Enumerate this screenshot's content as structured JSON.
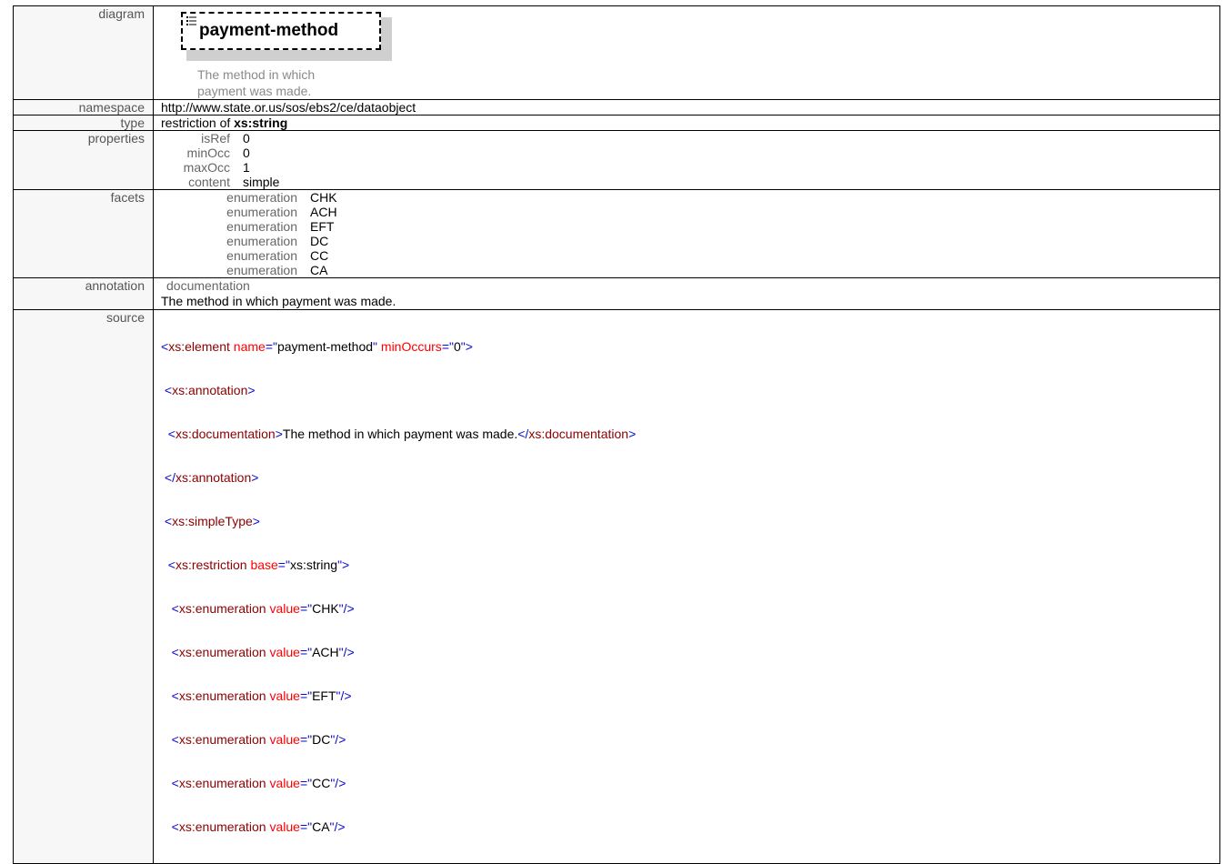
{
  "diagram": {
    "label": "diagram",
    "element_name": "payment-method",
    "element_doc": "The method in which payment was made.",
    "icon": "list-icon"
  },
  "namespace": {
    "label": "namespace",
    "value": "http://www.state.or.us/sos/ebs2/ce/dataobject"
  },
  "type": {
    "label": "type",
    "prefix": "restriction of ",
    "base": "xs:string"
  },
  "properties": {
    "label": "properties",
    "rows": [
      {
        "key": "isRef",
        "value": "0"
      },
      {
        "key": "minOcc",
        "value": "0"
      },
      {
        "key": "maxOcc",
        "value": "1"
      },
      {
        "key": "content",
        "value": "simple"
      }
    ]
  },
  "facets": {
    "label": "facets",
    "rows": [
      {
        "key": "enumeration",
        "value": "CHK"
      },
      {
        "key": "enumeration",
        "value": "ACH"
      },
      {
        "key": "enumeration",
        "value": "EFT"
      },
      {
        "key": "enumeration",
        "value": "DC"
      },
      {
        "key": "enumeration",
        "value": "CC"
      },
      {
        "key": "enumeration",
        "value": "CA"
      }
    ]
  },
  "annotation": {
    "label": "annotation",
    "kind": "documentation",
    "text": "The method in which payment was made."
  },
  "source": {
    "label": "source",
    "lines": [
      [
        {
          "t": "el",
          "s": "<"
        },
        {
          "t": "nm",
          "s": "xs:element"
        },
        {
          "t": "tx",
          "s": " "
        },
        {
          "t": "at",
          "s": "name"
        },
        {
          "t": "el",
          "s": "=\""
        },
        {
          "t": "av",
          "s": "payment-method"
        },
        {
          "t": "el",
          "s": "\""
        },
        {
          "t": "tx",
          "s": " "
        },
        {
          "t": "at",
          "s": "minOccurs"
        },
        {
          "t": "el",
          "s": "=\""
        },
        {
          "t": "av",
          "s": "0"
        },
        {
          "t": "el",
          "s": "\">"
        }
      ],
      [
        {
          "t": "tx",
          "s": " "
        },
        {
          "t": "el",
          "s": "<"
        },
        {
          "t": "nm",
          "s": "xs:annotation"
        },
        {
          "t": "el",
          "s": ">"
        }
      ],
      [
        {
          "t": "tx",
          "s": "  "
        },
        {
          "t": "el",
          "s": "<"
        },
        {
          "t": "nm",
          "s": "xs:documentation"
        },
        {
          "t": "el",
          "s": ">"
        },
        {
          "t": "tx",
          "s": "The method in which payment was made."
        },
        {
          "t": "el",
          "s": "</"
        },
        {
          "t": "nm",
          "s": "xs:documentation"
        },
        {
          "t": "el",
          "s": ">"
        }
      ],
      [
        {
          "t": "tx",
          "s": " "
        },
        {
          "t": "el",
          "s": "</"
        },
        {
          "t": "nm",
          "s": "xs:annotation"
        },
        {
          "t": "el",
          "s": ">"
        }
      ],
      [
        {
          "t": "tx",
          "s": " "
        },
        {
          "t": "el",
          "s": "<"
        },
        {
          "t": "nm",
          "s": "xs:simpleType"
        },
        {
          "t": "el",
          "s": ">"
        }
      ],
      [
        {
          "t": "tx",
          "s": "  "
        },
        {
          "t": "el",
          "s": "<"
        },
        {
          "t": "nm",
          "s": "xs:restriction"
        },
        {
          "t": "tx",
          "s": " "
        },
        {
          "t": "at",
          "s": "base"
        },
        {
          "t": "el",
          "s": "=\""
        },
        {
          "t": "av",
          "s": "xs:string"
        },
        {
          "t": "el",
          "s": "\">"
        }
      ],
      [
        {
          "t": "tx",
          "s": "   "
        },
        {
          "t": "el",
          "s": "<"
        },
        {
          "t": "nm",
          "s": "xs:enumeration"
        },
        {
          "t": "tx",
          "s": " "
        },
        {
          "t": "at",
          "s": "value"
        },
        {
          "t": "el",
          "s": "=\""
        },
        {
          "t": "av",
          "s": "CHK"
        },
        {
          "t": "el",
          "s": "\"/>"
        }
      ],
      [
        {
          "t": "tx",
          "s": "   "
        },
        {
          "t": "el",
          "s": "<"
        },
        {
          "t": "nm",
          "s": "xs:enumeration"
        },
        {
          "t": "tx",
          "s": " "
        },
        {
          "t": "at",
          "s": "value"
        },
        {
          "t": "el",
          "s": "=\""
        },
        {
          "t": "av",
          "s": "ACH"
        },
        {
          "t": "el",
          "s": "\"/>"
        }
      ],
      [
        {
          "t": "tx",
          "s": "   "
        },
        {
          "t": "el",
          "s": "<"
        },
        {
          "t": "nm",
          "s": "xs:enumeration"
        },
        {
          "t": "tx",
          "s": " "
        },
        {
          "t": "at",
          "s": "value"
        },
        {
          "t": "el",
          "s": "=\""
        },
        {
          "t": "av",
          "s": "EFT"
        },
        {
          "t": "el",
          "s": "\"/>"
        }
      ],
      [
        {
          "t": "tx",
          "s": "   "
        },
        {
          "t": "el",
          "s": "<"
        },
        {
          "t": "nm",
          "s": "xs:enumeration"
        },
        {
          "t": "tx",
          "s": " "
        },
        {
          "t": "at",
          "s": "value"
        },
        {
          "t": "el",
          "s": "=\""
        },
        {
          "t": "av",
          "s": "DC"
        },
        {
          "t": "el",
          "s": "\"/>"
        }
      ],
      [
        {
          "t": "tx",
          "s": "   "
        },
        {
          "t": "el",
          "s": "<"
        },
        {
          "t": "nm",
          "s": "xs:enumeration"
        },
        {
          "t": "tx",
          "s": " "
        },
        {
          "t": "at",
          "s": "value"
        },
        {
          "t": "el",
          "s": "=\""
        },
        {
          "t": "av",
          "s": "CC"
        },
        {
          "t": "el",
          "s": "\"/>"
        }
      ],
      [
        {
          "t": "tx",
          "s": "   "
        },
        {
          "t": "el",
          "s": "<"
        },
        {
          "t": "nm",
          "s": "xs:enumeration"
        },
        {
          "t": "tx",
          "s": " "
        },
        {
          "t": "at",
          "s": "value"
        },
        {
          "t": "el",
          "s": "=\""
        },
        {
          "t": "av",
          "s": "CA"
        },
        {
          "t": "el",
          "s": "\"/>"
        }
      ]
    ]
  }
}
